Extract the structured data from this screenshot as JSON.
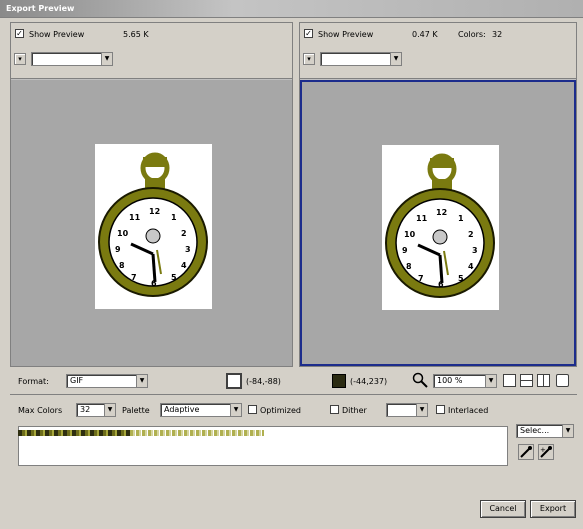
{
  "window": {
    "title": "Export Preview"
  },
  "left_panel": {
    "show_preview_label": "Show Preview",
    "show_preview_checked": true,
    "file_size": "5.65 K"
  },
  "right_panel": {
    "show_preview_label": "Show Preview",
    "show_preview_checked": true,
    "file_size": "0.47 K",
    "colors_label": "Colors:",
    "colors_value": "32"
  },
  "toolbar": {
    "format_label": "Format:",
    "format_value": "GIF",
    "crop_coords": "(-84,-88)",
    "pointer_coords": "(-44,237)",
    "zoom_value": "100 %"
  },
  "options": {
    "max_colors_label": "Max Colors",
    "max_colors_value": "32",
    "palette_label": "Palette",
    "palette_value": "Adaptive",
    "optimized_label": "Optimized",
    "dither_label": "Dither",
    "interlaced_label": "Interlaced",
    "select_label": "Selec..."
  },
  "buttons": {
    "cancel": "Cancel",
    "export": "Export"
  },
  "colors": {
    "watch_gold": "#7a7a10",
    "canvas_gray": "#a7a7a7",
    "active_border": "#1c2c8c"
  }
}
